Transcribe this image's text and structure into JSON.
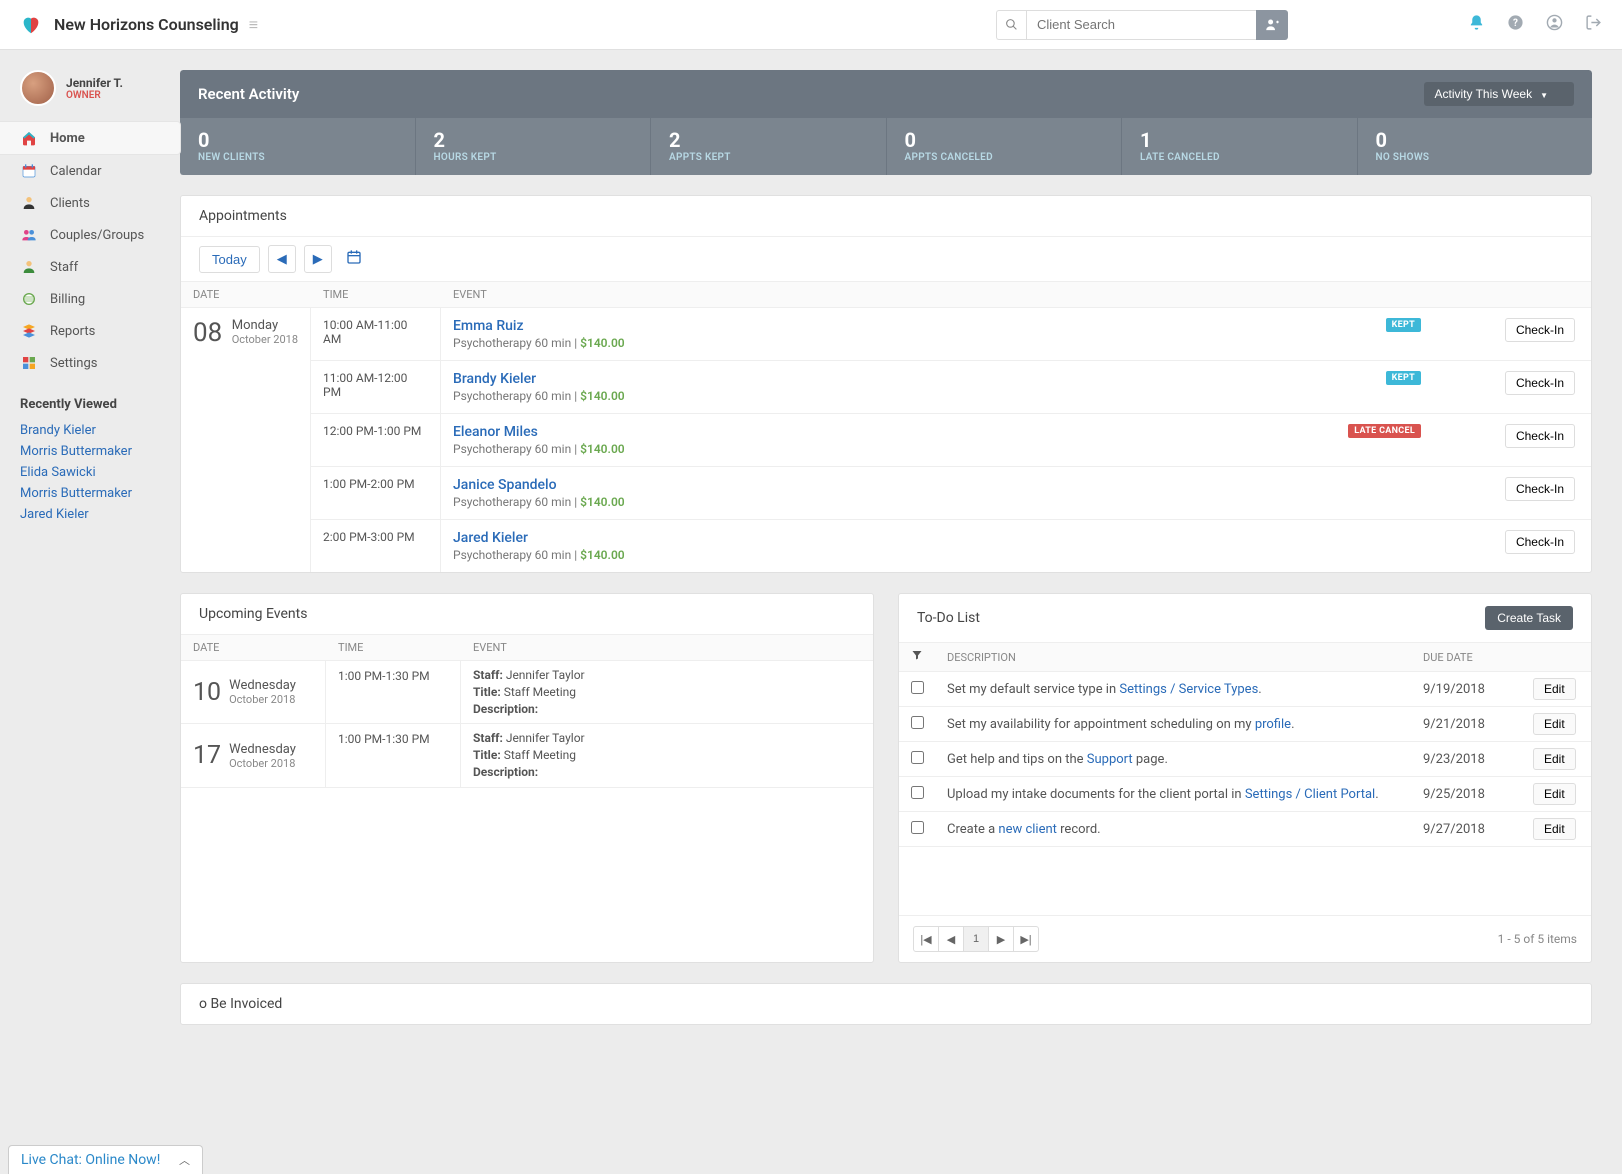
{
  "brand": "New Horizons Counseling",
  "search": {
    "placeholder": "Client Search"
  },
  "user": {
    "name": "Jennifer T.",
    "role": "OWNER"
  },
  "nav": {
    "home": "Home",
    "calendar": "Calendar",
    "clients": "Clients",
    "couples": "Couples/Groups",
    "staff": "Staff",
    "billing": "Billing",
    "reports": "Reports",
    "settings": "Settings"
  },
  "recently": {
    "title": "Recently Viewed",
    "items": [
      "Brandy Kieler",
      "Morris Buttermaker",
      "Elida Sawicki",
      "Morris Buttermaker",
      "Jared Kieler"
    ]
  },
  "recent": {
    "title": "Recent Activity",
    "select": "Activity This Week",
    "stats": [
      {
        "val": "0",
        "lbl": "NEW CLIENTS"
      },
      {
        "val": "2",
        "lbl": "HOURS KEPT"
      },
      {
        "val": "2",
        "lbl": "APPTS KEPT"
      },
      {
        "val": "0",
        "lbl": "APPTS CANCELED"
      },
      {
        "val": "1",
        "lbl": "LATE CANCELED"
      },
      {
        "val": "0",
        "lbl": "NO SHOWS"
      }
    ]
  },
  "appts": {
    "title": "Appointments",
    "today": "Today",
    "headers": {
      "date": "DATE",
      "time": "TIME",
      "event": "EVENT"
    },
    "date": {
      "num": "08",
      "day": "Monday",
      "month": "October 2018"
    },
    "rows": [
      {
        "time": "10:00 AM-11:00 AM",
        "client": "Emma Ruiz",
        "svc": "Psychotherapy 60 min",
        "price": "$140.00",
        "badge": "KEPT",
        "badgeClass": "kept"
      },
      {
        "time": "11:00 AM-12:00 PM",
        "client": "Brandy Kieler",
        "svc": "Psychotherapy 60 min",
        "price": "$140.00",
        "badge": "KEPT",
        "badgeClass": "kept"
      },
      {
        "time": "12:00 PM-1:00 PM",
        "client": "Eleanor Miles",
        "svc": "Psychotherapy 60 min",
        "price": "$140.00",
        "badge": "LATE CANCEL",
        "badgeClass": "late"
      },
      {
        "time": "1:00 PM-2:00 PM",
        "client": "Janice Spandelo",
        "svc": "Psychotherapy 60 min",
        "price": "$140.00",
        "badge": "",
        "badgeClass": ""
      },
      {
        "time": "2:00 PM-3:00 PM",
        "client": "Jared Kieler",
        "svc": "Psychotherapy 60 min",
        "price": "$140.00",
        "badge": "",
        "badgeClass": ""
      }
    ],
    "checkin": "Check-In"
  },
  "events": {
    "title": "Upcoming Events",
    "headers": {
      "date": "DATE",
      "time": "TIME",
      "event": "EVENT"
    },
    "labels": {
      "staff": "Staff:",
      "title": "Title:",
      "desc": "Description:"
    },
    "rows": [
      {
        "num": "10",
        "day": "Wednesday",
        "month": "October 2018",
        "time": "1:00 PM-1:30 PM",
        "staff": "Jennifer Taylor",
        "evtitle": "Staff Meeting",
        "desc": ""
      },
      {
        "num": "17",
        "day": "Wednesday",
        "month": "October 2018",
        "time": "1:00 PM-1:30 PM",
        "staff": "Jennifer Taylor",
        "evtitle": "Staff Meeting",
        "desc": ""
      }
    ]
  },
  "todo": {
    "title": "To-Do List",
    "create": "Create Task",
    "headers": {
      "desc": "DESCRIPTION",
      "due": "DUE DATE"
    },
    "edit": "Edit",
    "pager_info": "1 - 5 of 5 items",
    "page": "1",
    "rows": [
      {
        "pre": "Set my default service type in ",
        "link": "Settings / Service Types",
        "post": ".",
        "due": "9/19/2018"
      },
      {
        "pre": "Set my availability for appointment scheduling on my ",
        "link": "profile",
        "post": ".",
        "due": "9/21/2018"
      },
      {
        "pre": "Get help and tips on the ",
        "link": "Support",
        "post": " page.",
        "due": "9/23/2018"
      },
      {
        "pre": "Upload my intake documents for the client portal in ",
        "link": "Settings / Client Portal",
        "post": ".",
        "due": "9/25/2018"
      },
      {
        "pre": "Create a ",
        "link": "new client",
        "post": " record.",
        "due": "9/27/2018"
      }
    ]
  },
  "invoiced": {
    "title": "o Be Invoiced"
  },
  "chat": {
    "text": "Live Chat: Online Now!"
  }
}
